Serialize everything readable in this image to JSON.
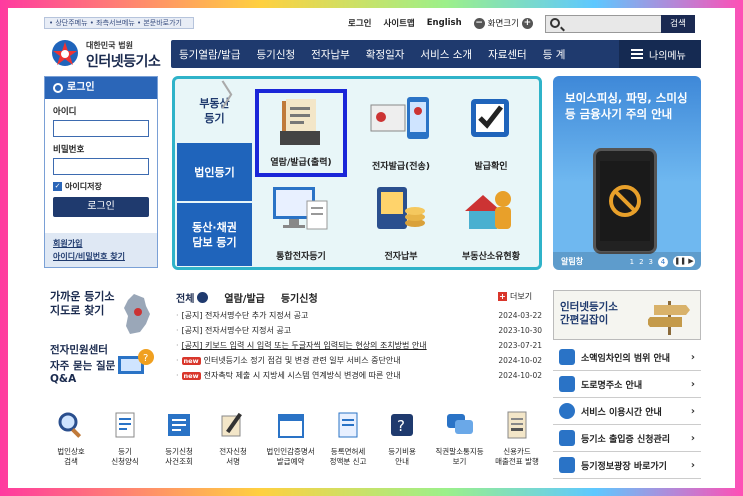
{
  "utility": {
    "skip_links": "• 상단주메뉴 • 좌측서브메뉴 • 본문바로가기",
    "login": "로그인",
    "sitemap": "사이트맵",
    "english": "English",
    "zoom_label": "화면크기",
    "search_button": "검색"
  },
  "logo": {
    "small": "대한민국 법원",
    "big": "인터넷등기소"
  },
  "nav": {
    "items": [
      "등기열람/발급",
      "등기신청",
      "전자납부",
      "확정일자",
      "서비스 소개",
      "자료센터",
      "등 계"
    ],
    "my_menu": "나의메뉴"
  },
  "login_box": {
    "title": "로그인",
    "id_label": "아이디",
    "pw_label": "비밀번호",
    "save_id": "아이디저장",
    "button": "로그인",
    "signup": "회원가입",
    "find": "아이디/비밀번호 찾기"
  },
  "center": {
    "categories": [
      "부동산 등기",
      "법인등기",
      "동산·채권 담보 등기"
    ],
    "tiles": [
      "열람/발급(출력)",
      "전자발급(전송)",
      "발급확인",
      "통합전자등기",
      "전자납부",
      "부동산소유현황"
    ]
  },
  "banner": {
    "title_line1": "보이스피싱, 파밍, 스미싱",
    "title_line2": "등 금융사기 주의 안내",
    "footer": "알림창",
    "pages": [
      "1",
      "2",
      "3",
      "4"
    ]
  },
  "lower_left": {
    "registry_line1": "가까운 등기소",
    "registry_line2": "지도로 찾기",
    "civil": "전자민원센터",
    "faq_line1": "자주 묻는 질문",
    "faq_line2": "Q&A"
  },
  "notice_tabs": {
    "all": "전체",
    "tab1": "열람/발급",
    "tab2": "등기신청",
    "more": "더보기"
  },
  "notices": [
    {
      "title": "[공지] 전자서명수단 추가 지정서 공고",
      "date": "2024-03-22",
      "new": false
    },
    {
      "title": "[공지] 전자서명수단 지정서 공고",
      "date": "2023-10-30",
      "new": false
    },
    {
      "title": "[공지] 키보드 입력 시 입력 또는 두글자씩 입력되는 현상의 조치방법 안내",
      "date": "2023-07-21",
      "new": false
    },
    {
      "title": "인터넷등기소 정기 점검 및 변경 관련 일부 서비스 중단안내",
      "date": "2024-10-02",
      "new": true
    },
    {
      "title": "전자촉탁 제출 시 지방세 시스템 연계방식 변경에 따른 안내",
      "date": "2024-10-02",
      "new": true
    }
  ],
  "new_badge": "new",
  "guide": {
    "line1": "인터넷등기소",
    "line2": "간편길잡이"
  },
  "side_links": [
    "소액임차인의 범위 안내",
    "도로명주소 안내",
    "서비스 이용시간 안내",
    "등기소 출입증 신청관리",
    "등기정보광장 바로가기"
  ],
  "quick": [
    [
      "법인상호",
      "검색"
    ],
    [
      "등기",
      "신청양식"
    ],
    [
      "등기신청",
      "사건조회"
    ],
    [
      "전자신청",
      "서명"
    ],
    [
      "법인인감증명서",
      "발급예약"
    ],
    [
      "등록면허세",
      "정액분 신고"
    ],
    [
      "등기비용",
      "안내"
    ],
    [
      "직권말소통지등",
      "보기"
    ],
    [
      "신용카드",
      "매출전표 발행"
    ]
  ],
  "colors": {
    "nav": "#1f3a6e",
    "accent": "#2a73c6",
    "panel_border": "#2fb3c9",
    "selected": "#1a26d8",
    "new": "#d9362b"
  }
}
